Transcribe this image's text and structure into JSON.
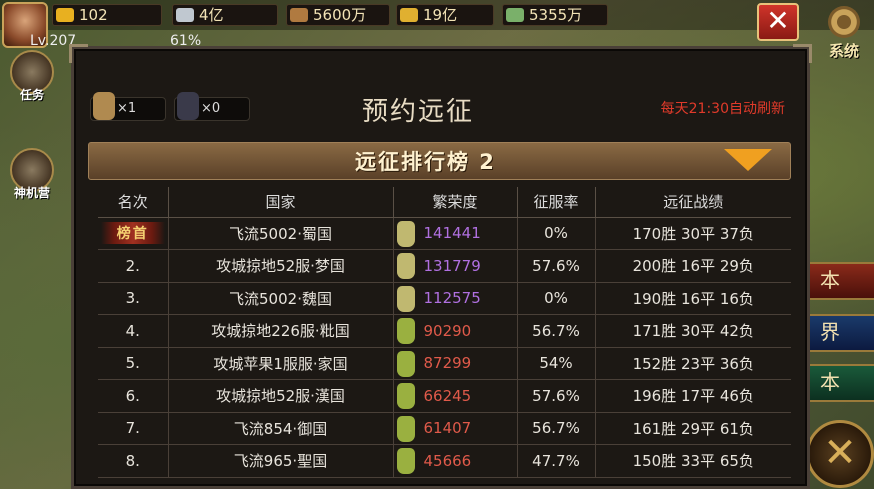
{
  "hud": {
    "level": "Lv.207",
    "level_pct": "61%",
    "resources": [
      {
        "icon": "gold-ingot-icon",
        "value": "102",
        "color": "#e8b020"
      },
      {
        "icon": "silver-icon",
        "value": "4亿",
        "color": "#c0c8d0"
      },
      {
        "icon": "wood-icon",
        "value": "5600万",
        "color": "#b07a40"
      },
      {
        "icon": "gold-bar-icon",
        "value": "19亿",
        "color": "#e0b030"
      },
      {
        "icon": "grain-icon",
        "value": "5355万",
        "color": "#7ab06a"
      }
    ],
    "system_label": "系统",
    "left_buttons": [
      "任务",
      "神机营"
    ],
    "side_buttons": [
      "本",
      "界",
      "本"
    ]
  },
  "modal": {
    "title": "预约远征",
    "refresh_note": "每天21:30自动刷新",
    "items": [
      {
        "icon": "bag-icon",
        "count": "×1"
      },
      {
        "icon": "bomb-icon",
        "count": "×0"
      }
    ],
    "leaderboard_title": "远征排行榜 2",
    "columns": [
      "名次",
      "国家",
      "繁荣度",
      "征服率",
      "远征战绩"
    ],
    "rows": [
      {
        "rank": "榜首",
        "country": "飞流5002·蜀国",
        "prosperity": "141441",
        "pcolor": "#b070e0",
        "bag": "#c0b870",
        "rate": "0%",
        "record": "170胜 30平 37负"
      },
      {
        "rank": "2.",
        "country": "攻城掠地52服·梦国",
        "prosperity": "131779",
        "pcolor": "#b070e0",
        "bag": "#c0b870",
        "rate": "57.6%",
        "record": "200胜 16平 29负"
      },
      {
        "rank": "3.",
        "country": "飞流5002·魏国",
        "prosperity": "112575",
        "pcolor": "#b070e0",
        "bag": "#c0b870",
        "rate": "0%",
        "record": "190胜 16平 16负"
      },
      {
        "rank": "4.",
        "country": "攻城掠地226服·粃国",
        "prosperity": "90290",
        "pcolor": "#e05a4a",
        "bag": "#9ab040",
        "rate": "56.7%",
        "record": "171胜 30平 42负"
      },
      {
        "rank": "5.",
        "country": "攻城苹果1服服·家国",
        "prosperity": "87299",
        "pcolor": "#e05a4a",
        "bag": "#9ab040",
        "rate": "54%",
        "record": "152胜 23平 36负"
      },
      {
        "rank": "6.",
        "country": "攻城掠地52服·漢国",
        "prosperity": "66245",
        "pcolor": "#e05a4a",
        "bag": "#9ab040",
        "rate": "57.6%",
        "record": "196胜 17平 46负"
      },
      {
        "rank": "7.",
        "country": "飞流854·御国",
        "prosperity": "61407",
        "pcolor": "#e05a4a",
        "bag": "#9ab040",
        "rate": "56.7%",
        "record": "161胜 29平 61负"
      },
      {
        "rank": "8.",
        "country": "飞流965·聖国",
        "prosperity": "45666",
        "pcolor": "#e05a4a",
        "bag": "#9ab040",
        "rate": "47.7%",
        "record": "150胜 33平 65负"
      }
    ]
  }
}
